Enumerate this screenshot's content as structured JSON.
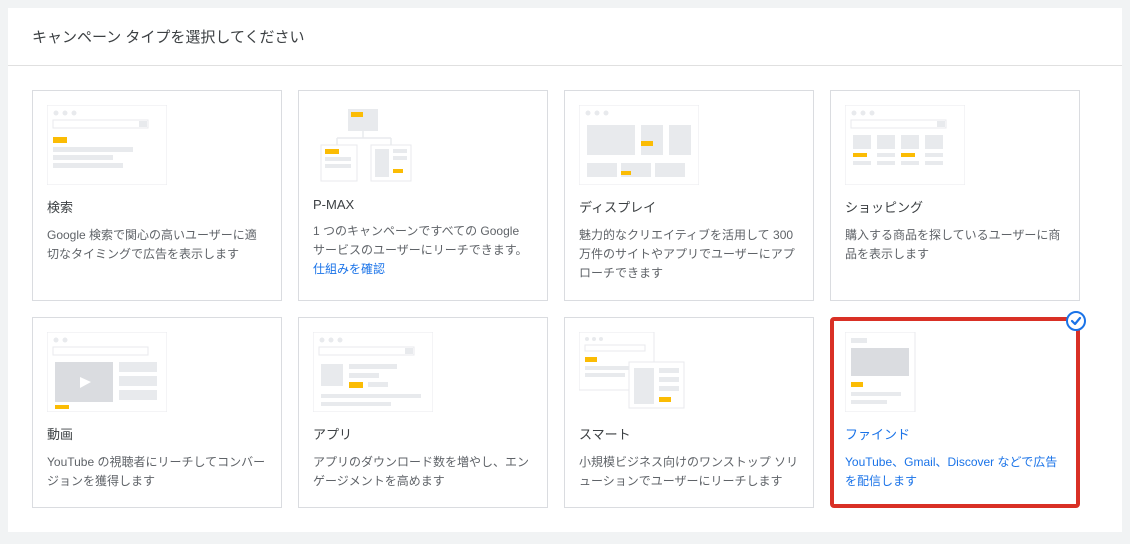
{
  "header": {
    "title": "キャンペーン タイプを選択してください"
  },
  "cards": [
    {
      "title": "検索",
      "desc": "Google 検索で関心の高いユーザーに適切なタイミングで広告を表示します",
      "link": ""
    },
    {
      "title": "P-MAX",
      "desc": "1 つのキャンペーンですべての Google サービスのユーザーにリーチできます。 ",
      "link": "仕組みを確認"
    },
    {
      "title": "ディスプレイ",
      "desc": "魅力的なクリエイティブを活用して 300 万件のサイトやアプリでユーザーにアプローチできます",
      "link": ""
    },
    {
      "title": "ショッピング",
      "desc": "購入する商品を探しているユーザーに商品を表示します",
      "link": ""
    },
    {
      "title": "動画",
      "desc": "YouTube の視聴者にリーチしてコンバージョンを獲得します",
      "link": ""
    },
    {
      "title": "アプリ",
      "desc": "アプリのダウンロード数を増やし、エンゲージメントを高めます",
      "link": ""
    },
    {
      "title": "スマート",
      "desc": "小規模ビジネス向けのワンストップ ソリューションでユーザーにリーチします",
      "link": ""
    },
    {
      "title": "ファインド",
      "desc": "YouTube、Gmail、Discover などで広告を配信します",
      "link": ""
    }
  ]
}
